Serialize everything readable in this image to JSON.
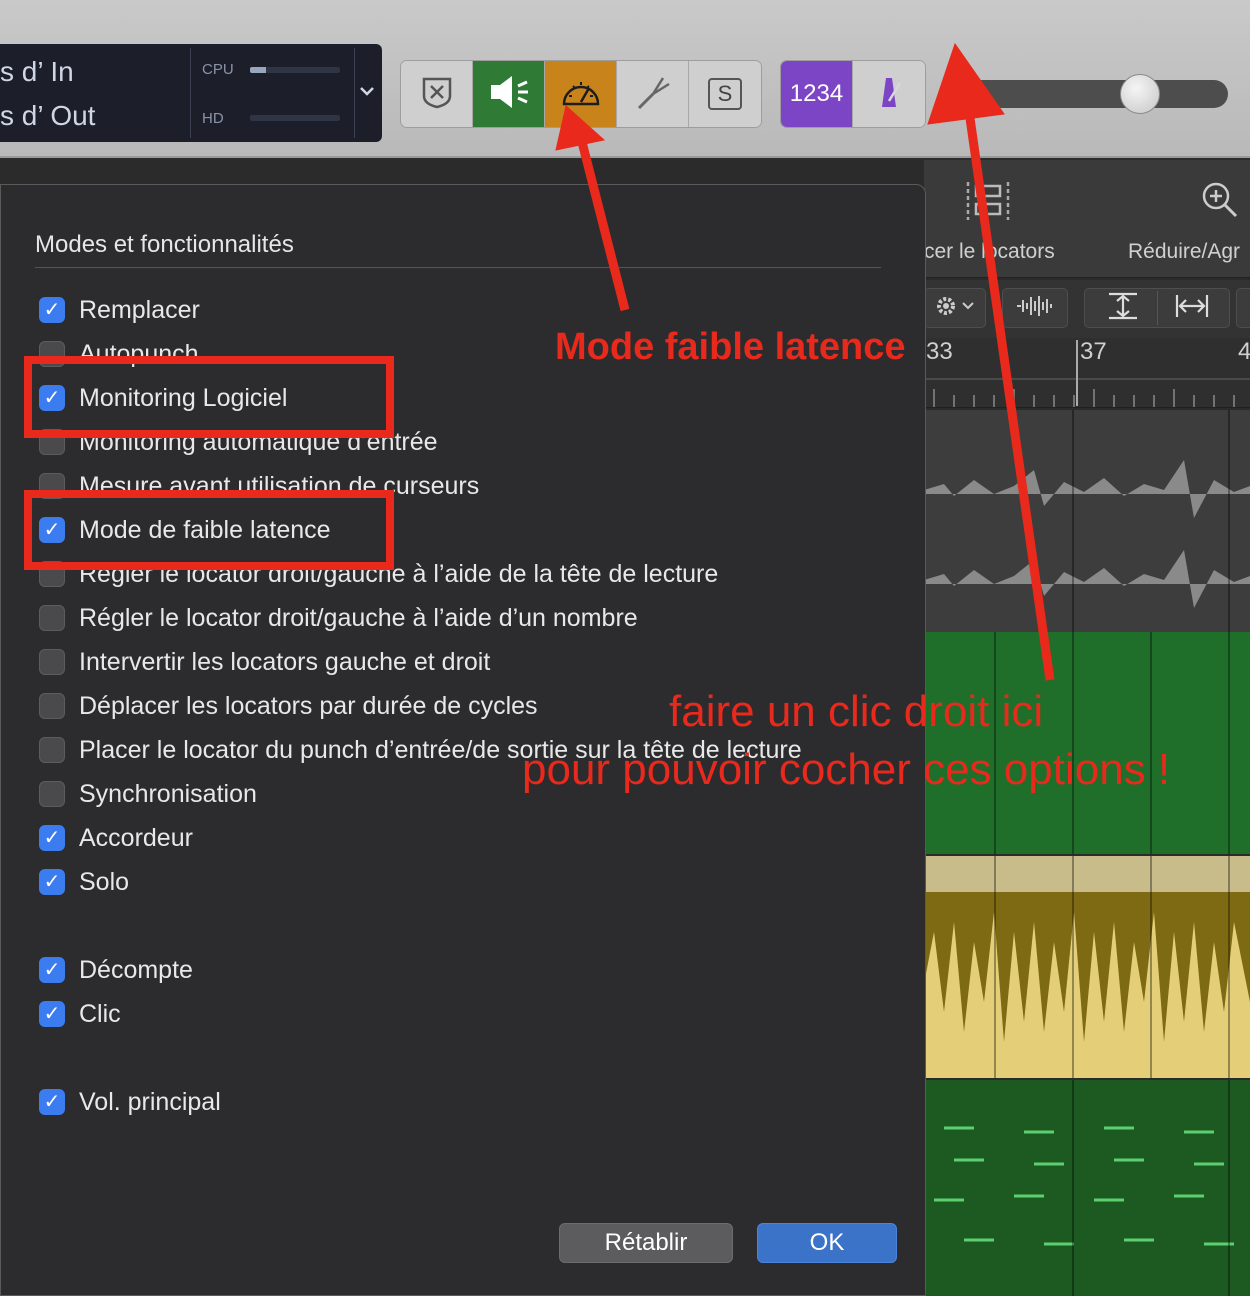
{
  "lcd": {
    "in_label": "s d’ In",
    "out_label": "s d’ Out",
    "cpu_label": "CPU",
    "hd_label": "HD",
    "cpu_level": 0.18,
    "hd_level": 0.0
  },
  "toolbar": {
    "group1_icons": [
      "replace-icon",
      "monitoring-speaker-icon",
      "low-latency-gauge-icon",
      "tuner-fork-icon",
      "solo-icon"
    ],
    "solo_label": "S",
    "count_in_label": "1234",
    "metronome_icon": "metronome-icon",
    "master_volume": 0.6
  },
  "arrange_toolbar": {
    "locators_label": "cer le locators",
    "zoom_label": "Réduire/Agr"
  },
  "ruler": {
    "marks": [
      "33",
      "37",
      "4"
    ]
  },
  "dialog": {
    "section_title": "Modes et fonctionnalités",
    "options": [
      {
        "label": "Remplacer",
        "checked": true
      },
      {
        "label": "Autopunch",
        "checked": false
      },
      {
        "label": "Monitoring Logiciel",
        "checked": true
      },
      {
        "label": "Monitoring automatique d’entrée",
        "checked": false
      },
      {
        "label": "Mesure avant utilisation de curseurs",
        "checked": false
      },
      {
        "label": "Mode de faible latence",
        "checked": true
      },
      {
        "label": "Régler le locator droit/gauche à l’aide de la tête de lecture",
        "checked": false
      },
      {
        "label": "Régler le locator droit/gauche à l’aide d’un nombre",
        "checked": false
      },
      {
        "label": "Intervertir les locators gauche et droit",
        "checked": false
      },
      {
        "label": "Déplacer les locators par durée de cycles",
        "checked": false
      },
      {
        "label": "Placer le locator du punch d’entrée/de sortie sur la tête de lecture",
        "checked": false
      },
      {
        "label": "Synchronisation",
        "checked": false
      },
      {
        "label": "Accordeur",
        "checked": true
      },
      {
        "label": "Solo",
        "checked": true
      },
      {
        "label": "Décompte",
        "checked": true
      },
      {
        "label": "Clic",
        "checked": true
      },
      {
        "label": "Vol. principal",
        "checked": true
      }
    ],
    "reset_label": "Rétablir",
    "ok_label": "OK"
  },
  "annotations": {
    "low_latency": "Mode faible latence",
    "right_click_1": "faire un clic droit ici",
    "right_click_2": "pour pouvoir cocher ces options !",
    "color": "#e8291c"
  },
  "colors": {
    "checkbox_on": "#3b7cf0",
    "monitoring_green": "#2f7a35",
    "latency_orange": "#c9831b",
    "count_in_purple": "#7b45c6",
    "ok_blue": "#3b73c8"
  }
}
